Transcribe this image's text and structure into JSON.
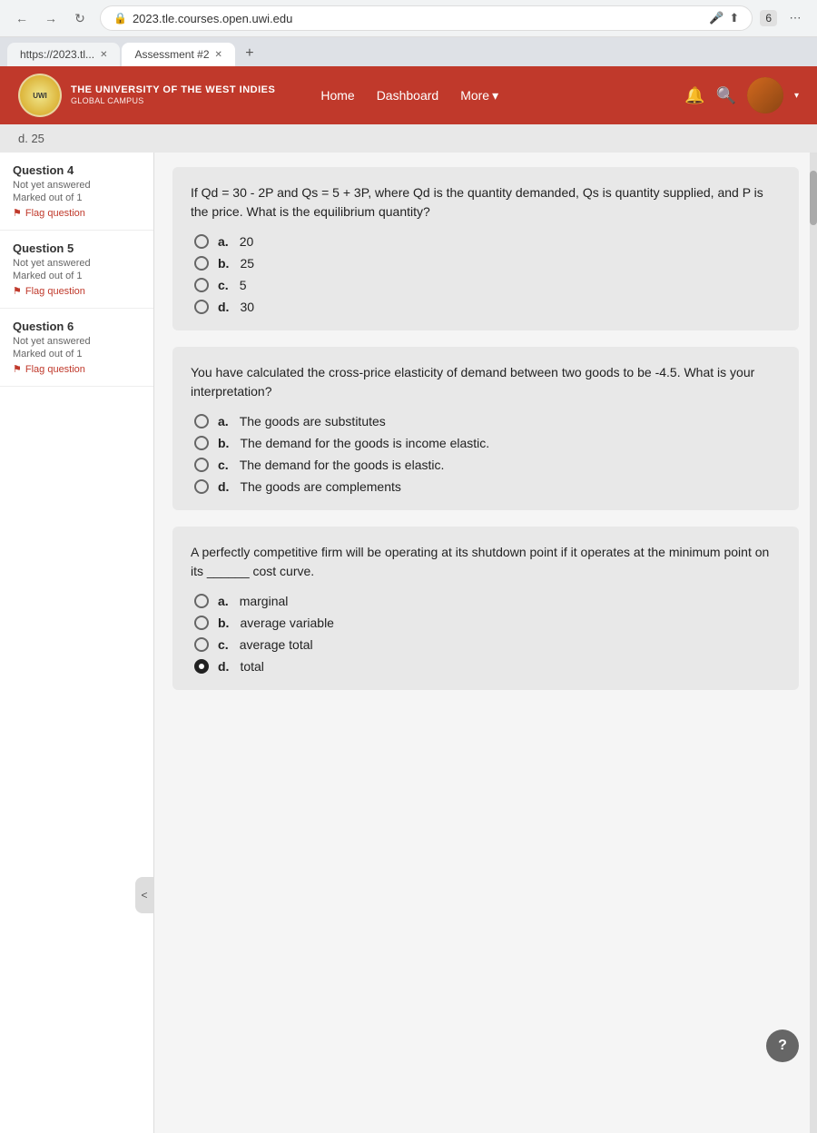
{
  "browser": {
    "url": "2023.tle.courses.open.uwi.edu",
    "tabs": [
      {
        "id": "tab1",
        "label": "https://2023.tl...",
        "active": false
      },
      {
        "id": "tab2",
        "label": "Assessment #2",
        "active": true
      }
    ],
    "extensions_count": "6"
  },
  "header": {
    "university_name": "THE UNIVERSITY OF THE WEST INDIES",
    "campus": "GLOBAL CAMPUS",
    "nav_items": [
      "Home",
      "Dashboard"
    ],
    "more_label": "More",
    "more_chevron": "▾"
  },
  "breadcrumb": {
    "text": "d. 25"
  },
  "questions": [
    {
      "id": "q4",
      "label": "Question 4",
      "status": "Not yet answered",
      "mark": "Marked out of 1",
      "flag_label": "Flag question",
      "text": "If Qd = 30 - 2P and Qs = 5 + 3P, where Qd is the quantity demanded, Qs is quantity supplied, and P is the price. What is the equilibrium quantity?",
      "options": [
        {
          "id": "q4a",
          "label": "a.",
          "text": "20",
          "selected": false
        },
        {
          "id": "q4b",
          "label": "b.",
          "text": "25",
          "selected": false
        },
        {
          "id": "q4c",
          "label": "c.",
          "text": "5",
          "selected": false
        },
        {
          "id": "q4d",
          "label": "d.",
          "text": "30",
          "selected": false
        }
      ]
    },
    {
      "id": "q5",
      "label": "Question 5",
      "status": "Not yet answered",
      "mark": "Marked out of 1",
      "flag_label": "Flag question",
      "text": "You have calculated the cross-price elasticity of demand between two goods to be -4.5. What is your interpretation?",
      "options": [
        {
          "id": "q5a",
          "label": "a.",
          "text": "The goods are substitutes",
          "selected": false
        },
        {
          "id": "q5b",
          "label": "b.",
          "text": "The demand for the goods is income elastic.",
          "selected": false
        },
        {
          "id": "q5c",
          "label": "c.",
          "text": "The demand for the goods is elastic.",
          "selected": false
        },
        {
          "id": "q5d",
          "label": "d.",
          "text": "The goods are complements",
          "selected": false
        }
      ]
    },
    {
      "id": "q6",
      "label": "Question 6",
      "status": "Not yet answered",
      "mark": "Marked out of 1",
      "flag_label": "Flag question",
      "text": "A perfectly competitive firm will be operating at its shutdown point if it operates at the minimum point on its ______ cost curve.",
      "options": [
        {
          "id": "q6a",
          "label": "a.",
          "text": "marginal",
          "selected": false
        },
        {
          "id": "q6b",
          "label": "b.",
          "text": "average variable",
          "selected": false
        },
        {
          "id": "q6c",
          "label": "c.",
          "text": "average total",
          "selected": false
        },
        {
          "id": "q6d",
          "label": "d.",
          "text": "total",
          "selected": true
        }
      ]
    }
  ],
  "ui": {
    "flag_symbol": "⚑",
    "collapse_symbol": "<",
    "help_label": "?",
    "dropdown_chevron": "▾"
  }
}
